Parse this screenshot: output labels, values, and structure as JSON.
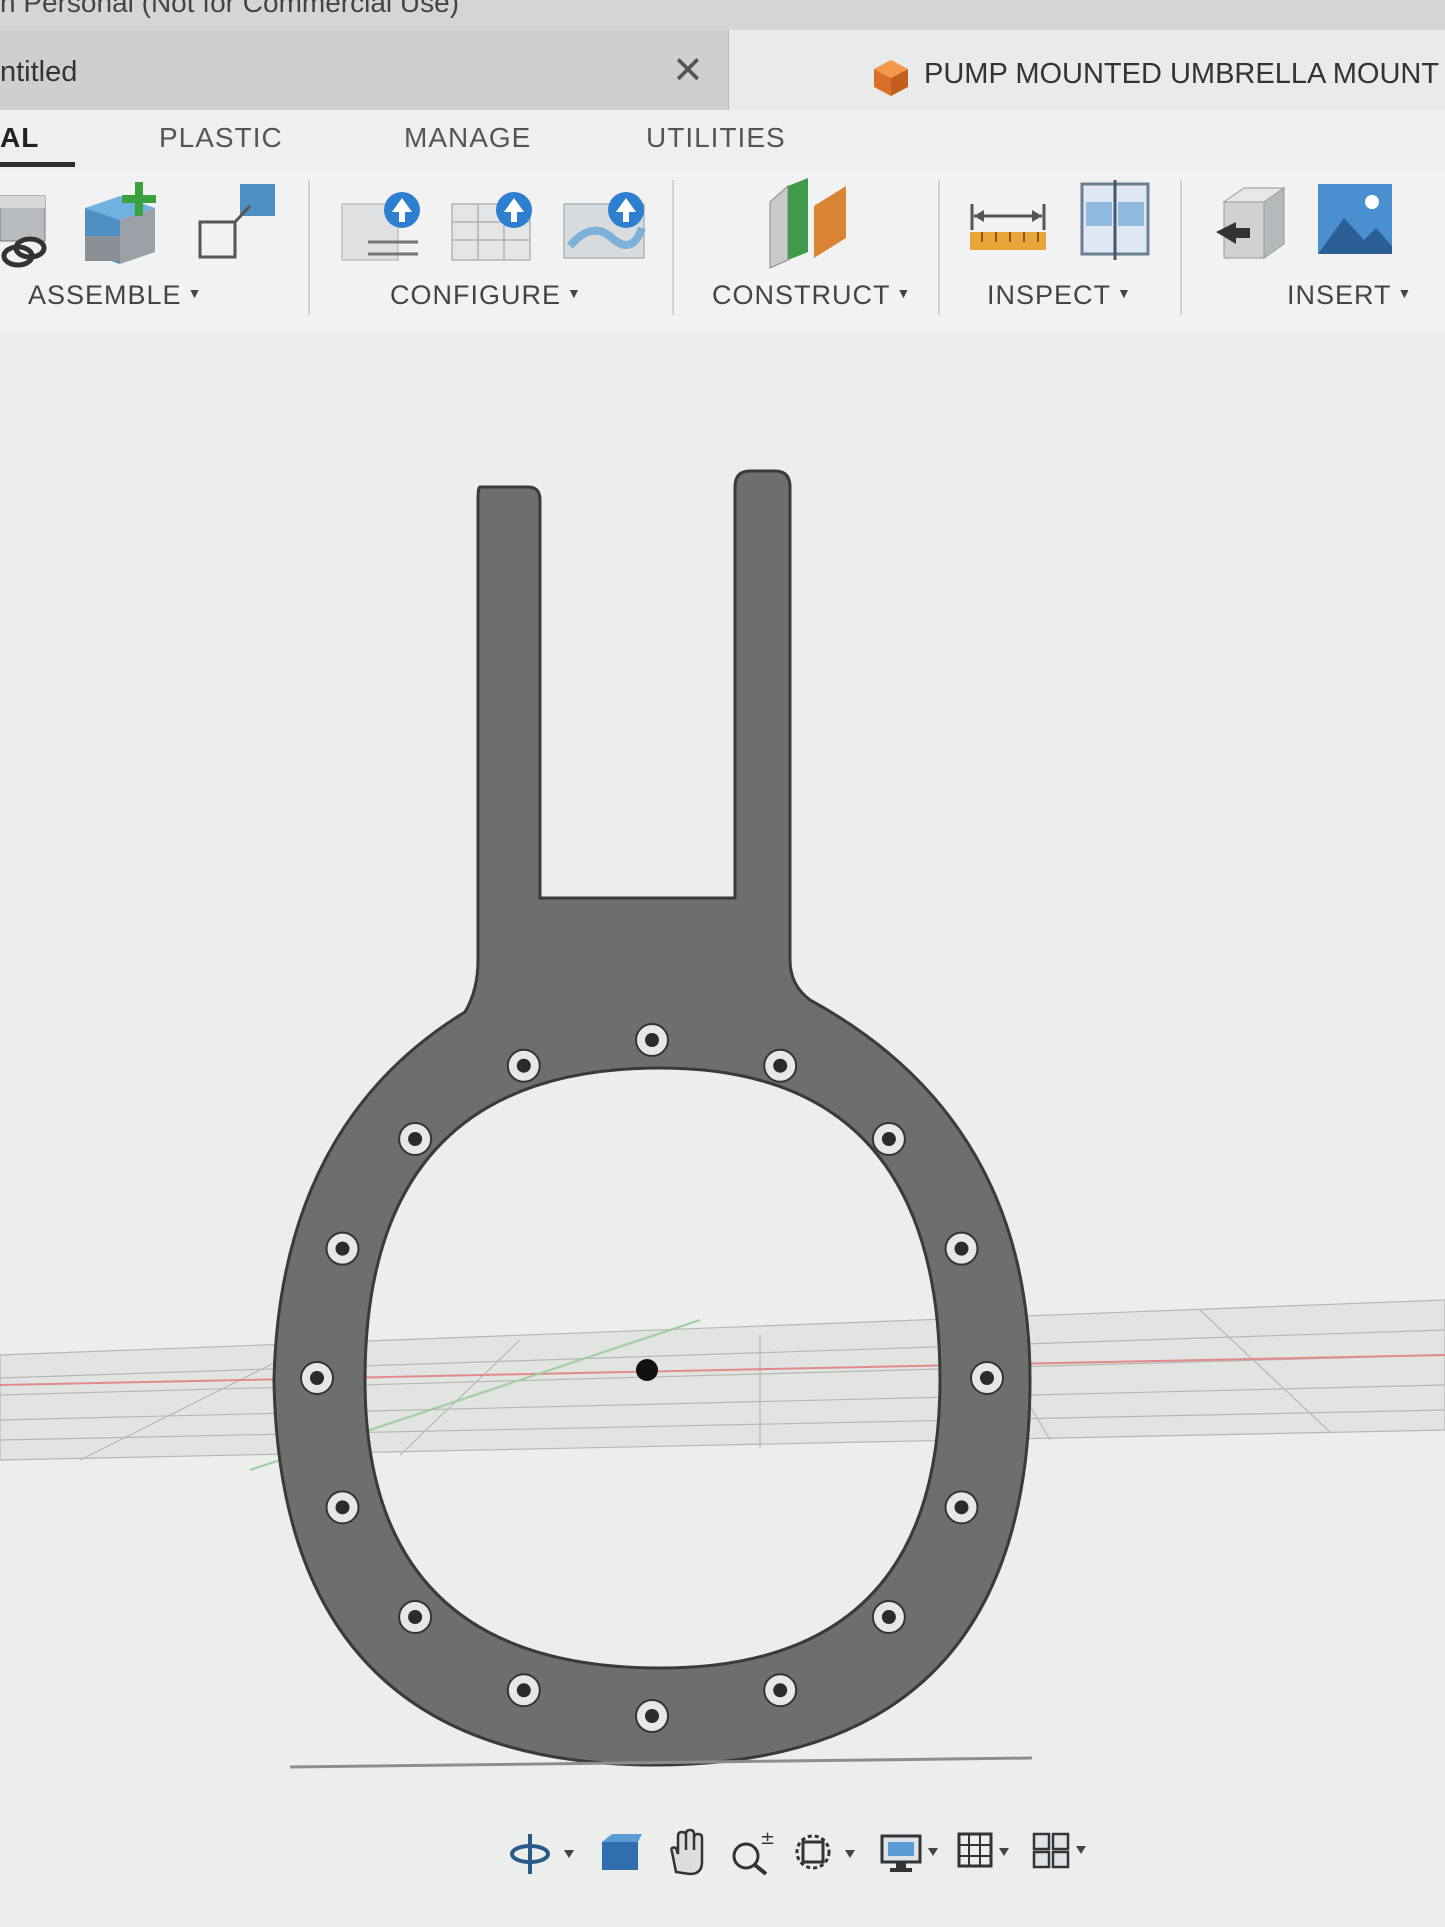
{
  "app_header": {
    "text": "n Personal (Not for Commercial Use)"
  },
  "document_tabs": [
    {
      "label": "ntitled",
      "active": false
    },
    {
      "label": "PUMP MOUNTED UMBRELLA MOUNT",
      "active": true,
      "icon": "orange-cube-icon"
    }
  ],
  "ribbon_tabs": [
    {
      "label": "AL",
      "active": true
    },
    {
      "label": "PLASTIC",
      "active": false
    },
    {
      "label": "MANAGE",
      "active": false
    },
    {
      "label": "UTILITIES",
      "active": false
    }
  ],
  "toolbar_groups": [
    {
      "label": "ASSEMBLE",
      "icons": [
        "joint-link-icon",
        "new-component-icon",
        "rigid-group-icon"
      ]
    },
    {
      "label": "CONFIGURE",
      "icons": [
        "configure-table-upload-icon",
        "configure-grid-upload-icon",
        "configure-map-upload-icon"
      ]
    },
    {
      "label": "CONSTRUCT",
      "icons": [
        "construct-plane-icon"
      ]
    },
    {
      "label": "INSPECT",
      "icons": [
        "measure-icon",
        "section-analysis-icon"
      ]
    },
    {
      "label": "INSERT",
      "icons": [
        "insert-derive-icon",
        "insert-image-icon"
      ]
    }
  ],
  "navigation_bar": {
    "icons": [
      "orbit-icon",
      "look-at-icon",
      "pan-icon",
      "zoom-icon",
      "fit-icon",
      "display-settings-icon",
      "grid-settings-icon",
      "viewports-icon"
    ]
  },
  "model": {
    "bolt_hole_count": 16
  },
  "colors": {
    "part_fill": "#6d6f6c",
    "part_edge": "#3a3b39",
    "cube_orange": "#e07a2c",
    "construct_green": "#3f9a4b",
    "construct_orange": "#d98535"
  }
}
